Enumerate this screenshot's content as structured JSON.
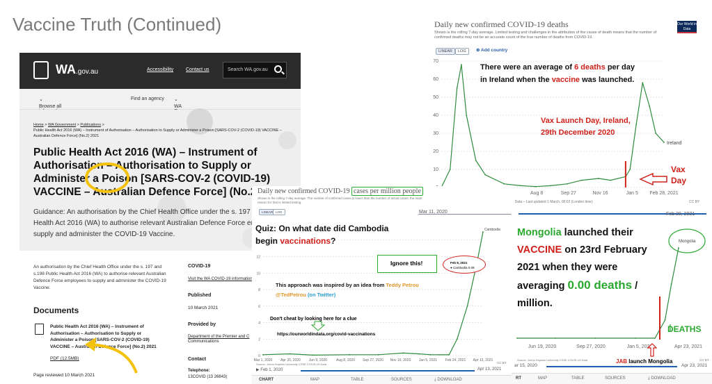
{
  "slide": {
    "title": "Vaccine Truth (Continued)"
  },
  "wa": {
    "logo": "WA",
    "logo_suffix": ".gov.au",
    "nav": [
      "Accessibility",
      "Contact us"
    ],
    "search_placeholder": "Search WA.gov.au",
    "menu": [
      "Browse all information and services",
      "Find an agency",
      "WA Government"
    ],
    "breadcrumb": [
      "Home",
      "WA Government",
      "Publications"
    ],
    "breadcrumb_tail": "Public Health Act 2016 (WA) – Instrument of Authorisation – Authorisation to Supply or Administer a Poison [SARS-COV-2 (COVID-19) VACCINE – Australian Defence Force] (No.2) 2021",
    "heading": "Public Health Act 2016 (WA) – Instrument of Authorisation – Authorisation to Supply or Administer a Poison [SARS-COV-2 (COVID-19) VACCINE – Australian Defence Force] (No.2)",
    "guidance": "Guidance: An authorisation by the Chief Health Office under the s. 197 of the Public Health Act 2016 (WA) to authorise relevant Australian Defence Force employees to supply and administer the COVID-19 Vaccine.",
    "summary": "An authorisation by the Chief Health Office under the s. 197 and s.198 Public Health Act 2016 (WA) to authorise relevant Australian Defence Force employees to supply and administer the COVID-19 Vaccine.",
    "documents_heading": "Documents",
    "doc_title": "Public Health Act 2016 (WA) – Instrument of Authorisation – Authorisation to Supply or Administer a Poison [SARS-COV-2 (COVID-19) VACCINE – Australian Defence Force] (No.2) 2021",
    "doc_link": "PDF (12.5MB)",
    "reviewed": "Page reviewed 10 March 2021",
    "side": {
      "covid_heading": "COVID-19",
      "covid_link": "Visit the WA COVID-19 information",
      "published_heading": "Published",
      "published_date": "10 March 2021",
      "provided_heading": "Provided by",
      "provided_link": "Department of the Premier and C",
      "provided_line2": "Communications",
      "contact_heading": "Contact",
      "telephone_label": "Telephone:",
      "telephone_value": "13COVID (13 26843)"
    }
  },
  "deaths_chart": {
    "title": "Daily new confirmed COVID-19 deaths",
    "subtitle": "Shown is the rolling 7-day average. Limited testing and challenges in the attribution of the cause of death means that the number of confirmed deaths may not be an accurate count of the true number of deaths from COVID-19.",
    "logo": "Our World in Data",
    "buttons": [
      "LINEAR",
      "LOG"
    ],
    "add_country": "Add country",
    "series_label": "Ireland",
    "source": "Source: Johns Hopkins University CSSE COVID-19 Data – Last updated 1 March, 00:02 (London time)",
    "cc": "CC BY",
    "slider_start": "Mar 11, 2020",
    "slider_end": "Feb 28, 2021",
    "annotation_line1_pre": "There were an average of ",
    "annotation_line1_hl": "6 deaths",
    "annotation_line1_post": " per day",
    "annotation_line2_pre": "in Ireland when the ",
    "annotation_line2_hl": "vaccine",
    "annotation_line2_post": " was launched.",
    "vax_launch_line1": "Vax Launch Day, Ireland,",
    "vax_launch_line2": "29th December 2020",
    "vax_day_line1": "Vax",
    "vax_day_line2": "Day"
  },
  "cases_chart": {
    "title_pre": "Daily new confirmed COVID-19 ",
    "title_hl": "cases per million people",
    "subtitle": "Shown is the rolling 7-day average. The number of confirmed cases is lower than the number of actual cases; the main reason for that is limited testing.",
    "buttons": [
      "LINEAR",
      "LOG"
    ],
    "series_label": "Cambodia",
    "tooltip_date": "Feb 9, 2021",
    "tooltip_series": "Cambodia",
    "tooltip_value": "0.09",
    "quiz_line1": "Quiz: On what date did Cambodia",
    "quiz_line2_pre": "begin ",
    "quiz_line2_hl": "vaccinations",
    "quiz_line2_post": "?",
    "ignore": "Ignore this!",
    "inspired_pre": "This approach was inspired by an idea from ",
    "inspired_name": "Teddy Petrou",
    "inspired_handle": "@TedPetrou",
    "inspired_twitter": "(on Twitter)",
    "dont_cheat": "Don't cheat by looking here for a clue",
    "url": "https://ourworldindata.org/covid-vaccinations",
    "source": "Source: Johns Hopkins University CSSE COVID-19 Data",
    "cc": "CC BY",
    "slider_start": "Feb 1, 2020",
    "slider_end": "Apr 13, 2021",
    "tabs": [
      "CHART",
      "MAP",
      "TABLE",
      "SOURCES",
      "DOWNLOAD"
    ]
  },
  "mongolia_chart": {
    "series_label": "Mongolia",
    "line1_hl": "Mongolia",
    "line1_post": " launched their",
    "line2_hl": "VACCINE",
    "line2_post": " on 23rd February",
    "line3": "2021 when they were",
    "line4_pre": "averaging ",
    "line4_hl": "0.00 deaths",
    "line4_post": " /",
    "line5": "million.",
    "deaths_label": "DEATHS",
    "jab_pre": "JAB",
    "jab_post": " launch Mongolia",
    "source": "Source: Johns Hopkins University CSSE COVID-19 Data",
    "cc": "CC BY",
    "slider_start": "ar 15, 2020",
    "slider_end": "Apr 23, 2021",
    "tabs": [
      "RT",
      "MAP",
      "TABLE",
      "SOURCES",
      "DOWNLOAD"
    ]
  },
  "chart_data": [
    {
      "type": "line",
      "title": "Daily new confirmed COVID-19 deaths",
      "series": [
        {
          "name": "Ireland",
          "points": [
            [
              "Mar 11, 2020",
              0
            ],
            [
              "Mar 25, 2020",
              10
            ],
            [
              "Apr 5, 2020",
              55
            ],
            [
              "Apr 12, 2020",
              68
            ],
            [
              "Apr 20, 2020",
              40
            ],
            [
              "May 5, 2020",
              15
            ],
            [
              "May 20, 2020",
              7
            ],
            [
              "Jun 19, 2020",
              2
            ],
            [
              "Jul 15, 2020",
              1
            ],
            [
              "Aug 8, 2020",
              0.5
            ],
            [
              "Sep 1, 2020",
              1
            ],
            [
              "Sep 27, 2020",
              2
            ],
            [
              "Oct 20, 2020",
              4
            ],
            [
              "Nov 16, 2020",
              5
            ],
            [
              "Dec 5, 2020",
              4
            ],
            [
              "Dec 29, 2020",
              6
            ],
            [
              "Jan 5, 2021",
              10
            ],
            [
              "Jan 15, 2021",
              35
            ],
            [
              "Jan 25, 2021",
              58
            ],
            [
              "Feb 5, 2021",
              45
            ],
            [
              "Feb 15, 2021",
              30
            ],
            [
              "Feb 28, 2021",
              25
            ]
          ]
        }
      ],
      "x_ticks": [
        "Mar 11, 2020",
        "Apr 30",
        "Jun 19",
        "Aug 8",
        "Sep 27",
        "Nov 16",
        "Jan 5",
        "Feb 28, 2021"
      ],
      "y_ticks": [
        0,
        10,
        20,
        30,
        40,
        50,
        60,
        70
      ],
      "ylim": [
        0,
        70
      ]
    },
    {
      "type": "line",
      "title": "Daily new confirmed COVID-19 cases per million people",
      "series": [
        {
          "name": "Cambodia",
          "points": [
            [
              "Mar 1, 2020",
              0.1
            ],
            [
              "Apr 20, 2020",
              0.2
            ],
            [
              "Jun 1, 2020",
              0.05
            ],
            [
              "Aug 8, 2020",
              0.1
            ],
            [
              "Oct 1, 2020",
              0.1
            ],
            [
              "Nov 16, 2020",
              0.3
            ],
            [
              "Dec 15, 2020",
              0.2
            ],
            [
              "Jan 5, 2021",
              0.1
            ],
            [
              "Feb 9, 2021",
              0.09
            ],
            [
              "Feb 24, 2021",
              2
            ],
            [
              "Mar 15, 2021",
              6
            ],
            [
              "Apr 1, 2021",
              11
            ],
            [
              "Apr 13, 2021",
              15
            ]
          ]
        }
      ],
      "x_ticks": [
        "Mar 1, 2020",
        "Apr 20, 2020",
        "Jun 9, 2020",
        "Aug 8, 2020",
        "Sep 27, 2020",
        "Nov 16, 2020",
        "Jan 5, 2021",
        "Feb 24, 2021",
        "Apr 13, 2021"
      ],
      "y_ticks": [
        0,
        2,
        4,
        6,
        8,
        10,
        12,
        14
      ],
      "ylim": [
        0,
        16
      ]
    },
    {
      "type": "line",
      "title": "",
      "series": [
        {
          "name": "Mongolia",
          "points": [
            [
              "Mar 15, 2020",
              0
            ],
            [
              "Jun 19, 2020",
              0
            ],
            [
              "Sep 27, 2020",
              0
            ],
            [
              "Jan 5, 2021",
              0
            ],
            [
              "Feb 23, 2021",
              0
            ],
            [
              "Mar 20, 2021",
              0.3
            ],
            [
              "Apr 5, 2021",
              0.9
            ],
            [
              "Apr 23, 2021",
              1.5
            ]
          ]
        }
      ],
      "x_ticks": [
        "Jun 19, 2020",
        "Sep 27, 2020",
        "Jan 5, 2021",
        "Apr 23, 2021"
      ]
    }
  ]
}
